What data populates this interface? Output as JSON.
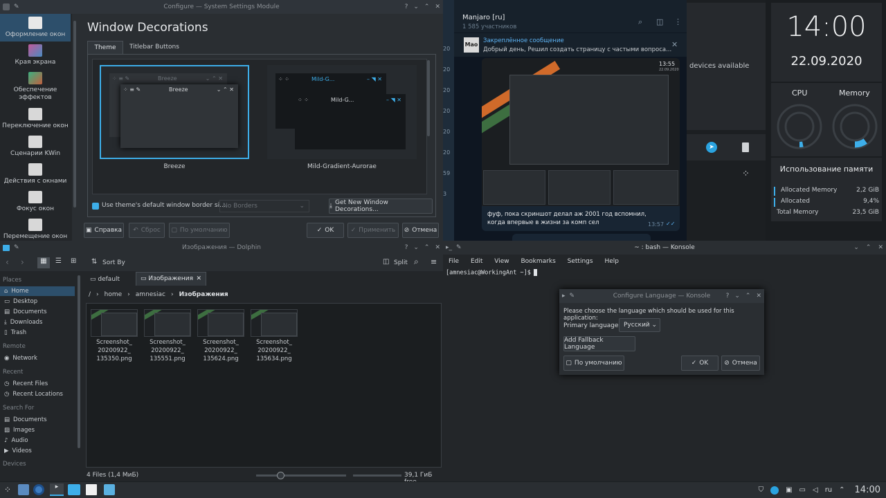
{
  "settings": {
    "title": "Configure — System Settings Module",
    "heading": "Window Decorations",
    "tabs": [
      "Theme",
      "Titlebar Buttons"
    ],
    "sidebar": [
      "Оформление окон",
      "Края экрана",
      "Обеспечение эффектов",
      "Переключение окон",
      "Сценарии KWin",
      "Действия с окнами",
      "Фокус окон",
      "Перемещение окон"
    ],
    "themes": [
      {
        "name": "Breeze",
        "preview": "Breeze"
      },
      {
        "name": "Mild-Gradient-Aurorae",
        "preview": "Mild-G..."
      }
    ],
    "border_check": "Use theme's default window border si...",
    "border_select": "No Borders",
    "get_new": "Get New Window Decorations...",
    "buttons": {
      "help": "Справка",
      "reset": "Сброс",
      "defaults": "По умолчанию",
      "ok": "OK",
      "apply": "Применить",
      "cancel": "Отмена"
    }
  },
  "telegram": {
    "title": "Manjaro [ru]",
    "subtitle": "1 585 участников",
    "pinned_label": "Закреплённое сообщение",
    "pinned_text": "Добрый день, Решил создать страницу с частыми вопроса...",
    "avatar_text": "Mao",
    "msg_text": "фуф, пока скриншот делал аж 2001 год вспомнил, когда впервые в жизни за комп сел",
    "msg_time": "13:57",
    "img_time": "13:55",
    "img_date": "22.09.2020",
    "left_numbers": [
      "20",
      "20",
      "20",
      "20",
      "20",
      "20",
      "59",
      "3"
    ]
  },
  "devices": {
    "text": "devices available"
  },
  "clock": {
    "time": "14:00",
    "date": "22.09.2020"
  },
  "gauges": {
    "cpu_label": "CPU",
    "mem_label": "Memory",
    "cpu": 0.03,
    "mem": 0.1
  },
  "memory": {
    "title": "Использование памяти",
    "rows": [
      {
        "label": "Allocated Memory",
        "value": "2,2 GiB"
      },
      {
        "label": "Allocated",
        "value": "9,4%"
      },
      {
        "label": "Total Memory",
        "value": "23,5 GiB"
      }
    ]
  },
  "dolphin": {
    "title": "Изображения — Dolphin",
    "sort": "Sort By",
    "split": "Split",
    "tabs": [
      "default",
      "Изображения"
    ],
    "crumbs": [
      "/",
      "home",
      "amnesiac",
      "Изображения"
    ],
    "places_h": "Places",
    "places": [
      "Home",
      "Desktop",
      "Documents",
      "Downloads",
      "Trash"
    ],
    "remote_h": "Remote",
    "remote": [
      "Network"
    ],
    "recent_h": "Recent",
    "recent": [
      "Recent Files",
      "Recent Locations"
    ],
    "search_h": "Search For",
    "search": [
      "Documents",
      "Images",
      "Audio",
      "Videos"
    ],
    "devices_h": "Devices",
    "files": [
      {
        "l1": "Screenshot_",
        "l2": "20200922_",
        "l3": "135350.png"
      },
      {
        "l1": "Screenshot_",
        "l2": "20200922_",
        "l3": "135551.png"
      },
      {
        "l1": "Screenshot_",
        "l2": "20200922_",
        "l3": "135624.png"
      },
      {
        "l1": "Screenshot_",
        "l2": "20200922_",
        "l3": "135634.png"
      }
    ],
    "status": "4 Files (1,4 МиБ)",
    "free": "39,1 ГиБ free"
  },
  "konsole": {
    "title": "~ : bash — Konsole",
    "menu": [
      "File",
      "Edit",
      "View",
      "Bookmarks",
      "Settings",
      "Help"
    ],
    "prompt": "[amnesiac@WorkingAnt ~]$"
  },
  "lang": {
    "title": "Configure Language — Konsole",
    "msg": "Please choose the language which should be used for this application:",
    "primary": "Primary language:",
    "select": "Русский",
    "fallback": "Add Fallback Language",
    "defaults": "По умолчанию",
    "ok": "OK",
    "cancel": "Отмена"
  },
  "taskbar": {
    "lang": "ru",
    "time": "14:00"
  }
}
